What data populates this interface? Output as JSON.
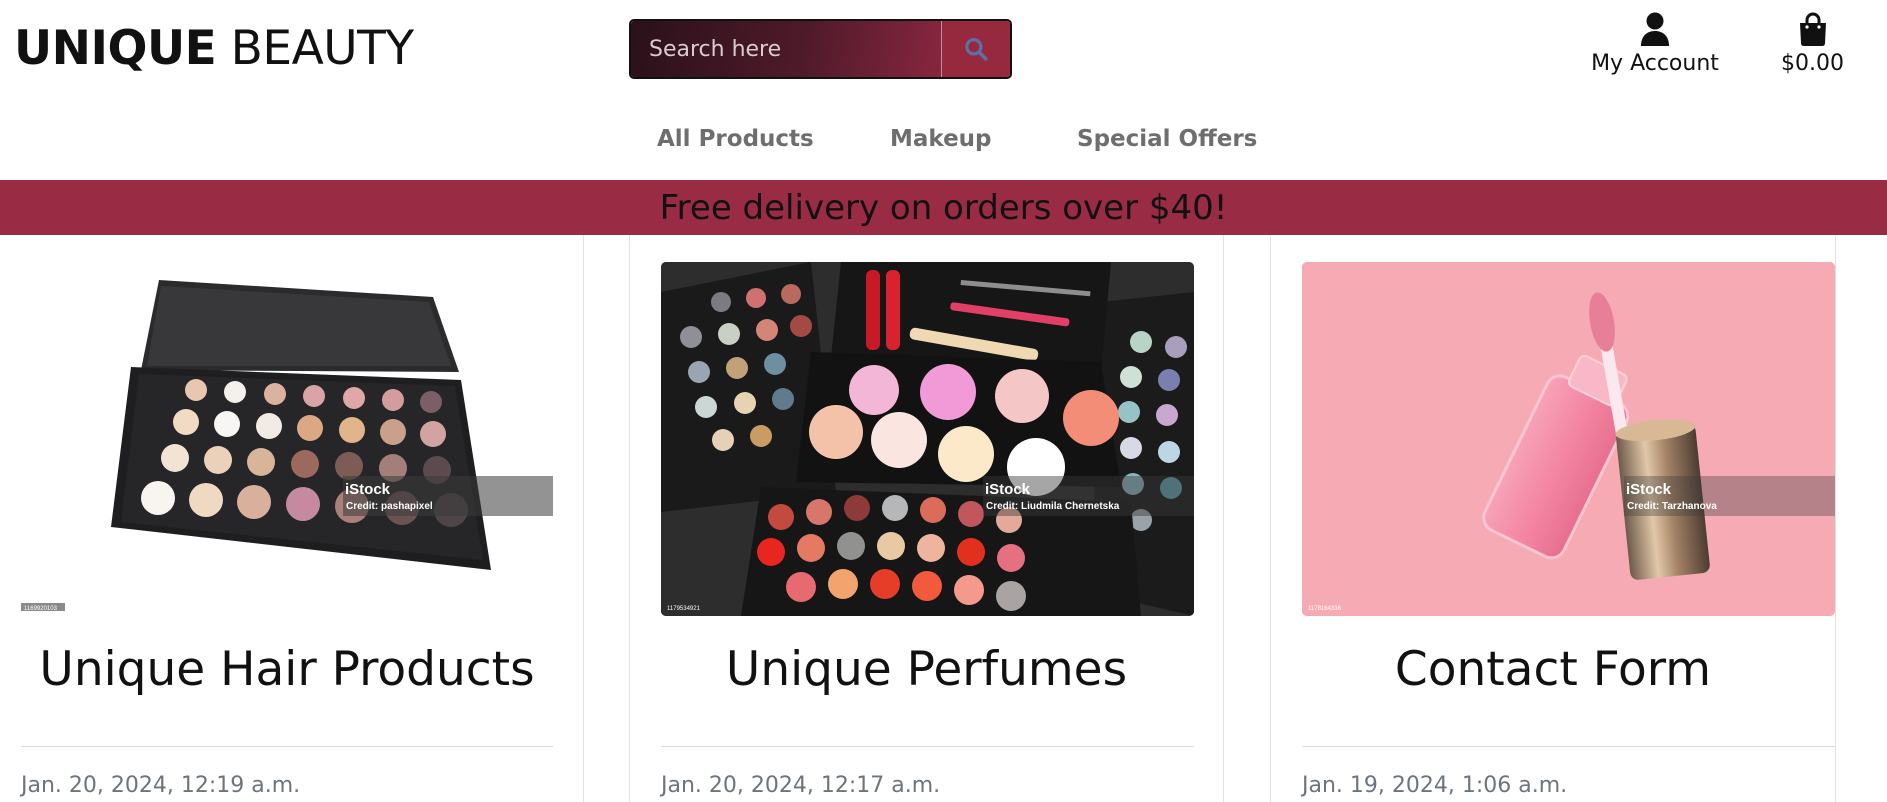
{
  "header": {
    "brand_bold": "UNIQUE",
    "brand_light": "BEAUTY",
    "search_placeholder": "Search here",
    "account_label": "My Account",
    "cart_total": "$0.00"
  },
  "nav": {
    "items": [
      {
        "label": "All Products"
      },
      {
        "label": "Makeup"
      },
      {
        "label": "Special Offers"
      }
    ]
  },
  "banner": {
    "text": "Free delivery on orders over $40!"
  },
  "cards": [
    {
      "title": "Unique Hair Products",
      "date": "Jan. 20, 2024, 12:19 a.m.",
      "image": {
        "brand": "iStock",
        "credit": "Credit: pashapixel",
        "stock_id": "1169920103"
      }
    },
    {
      "title": "Unique Perfumes",
      "date": "Jan. 20, 2024, 12:17 a.m.",
      "image": {
        "brand": "iStock",
        "credit": "Credit: Liudmila Chernetska",
        "stock_id": "1179534921"
      }
    },
    {
      "title": "Contact Form",
      "date": "Jan. 19, 2024, 1:06 a.m.",
      "image": {
        "brand": "iStock",
        "credit": "Credit: Tarzhanova",
        "stock_id": "1178164336"
      }
    }
  ],
  "icons": {
    "search": "search-icon",
    "account": "user-icon",
    "cart": "shopping-bag-icon"
  },
  "colors": {
    "accent": "#9a2b45",
    "search_button": "#97293f",
    "nav_text": "#6e6e6e",
    "date_text": "#6c757d"
  }
}
